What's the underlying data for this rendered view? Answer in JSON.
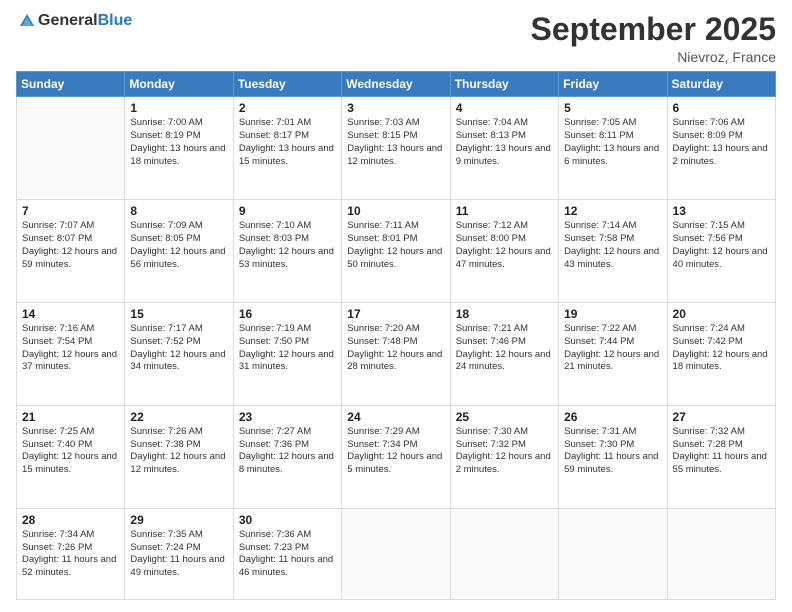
{
  "header": {
    "logo": {
      "text_general": "General",
      "text_blue": "Blue"
    },
    "title": "September 2025",
    "location": "Nievroz, France"
  },
  "calendar": {
    "days": [
      "Sunday",
      "Monday",
      "Tuesday",
      "Wednesday",
      "Thursday",
      "Friday",
      "Saturday"
    ],
    "weeks": [
      [
        {
          "day": "",
          "info": ""
        },
        {
          "day": "1",
          "info": "Sunrise: 7:00 AM\nSunset: 8:19 PM\nDaylight: 13 hours\nand 18 minutes."
        },
        {
          "day": "2",
          "info": "Sunrise: 7:01 AM\nSunset: 8:17 PM\nDaylight: 13 hours\nand 15 minutes."
        },
        {
          "day": "3",
          "info": "Sunrise: 7:03 AM\nSunset: 8:15 PM\nDaylight: 13 hours\nand 12 minutes."
        },
        {
          "day": "4",
          "info": "Sunrise: 7:04 AM\nSunset: 8:13 PM\nDaylight: 13 hours\nand 9 minutes."
        },
        {
          "day": "5",
          "info": "Sunrise: 7:05 AM\nSunset: 8:11 PM\nDaylight: 13 hours\nand 6 minutes."
        },
        {
          "day": "6",
          "info": "Sunrise: 7:06 AM\nSunset: 8:09 PM\nDaylight: 13 hours\nand 2 minutes."
        }
      ],
      [
        {
          "day": "7",
          "info": "Sunrise: 7:07 AM\nSunset: 8:07 PM\nDaylight: 12 hours\nand 59 minutes."
        },
        {
          "day": "8",
          "info": "Sunrise: 7:09 AM\nSunset: 8:05 PM\nDaylight: 12 hours\nand 56 minutes."
        },
        {
          "day": "9",
          "info": "Sunrise: 7:10 AM\nSunset: 8:03 PM\nDaylight: 12 hours\nand 53 minutes."
        },
        {
          "day": "10",
          "info": "Sunrise: 7:11 AM\nSunset: 8:01 PM\nDaylight: 12 hours\nand 50 minutes."
        },
        {
          "day": "11",
          "info": "Sunrise: 7:12 AM\nSunset: 8:00 PM\nDaylight: 12 hours\nand 47 minutes."
        },
        {
          "day": "12",
          "info": "Sunrise: 7:14 AM\nSunset: 7:58 PM\nDaylight: 12 hours\nand 43 minutes."
        },
        {
          "day": "13",
          "info": "Sunrise: 7:15 AM\nSunset: 7:56 PM\nDaylight: 12 hours\nand 40 minutes."
        }
      ],
      [
        {
          "day": "14",
          "info": "Sunrise: 7:16 AM\nSunset: 7:54 PM\nDaylight: 12 hours\nand 37 minutes."
        },
        {
          "day": "15",
          "info": "Sunrise: 7:17 AM\nSunset: 7:52 PM\nDaylight: 12 hours\nand 34 minutes."
        },
        {
          "day": "16",
          "info": "Sunrise: 7:19 AM\nSunset: 7:50 PM\nDaylight: 12 hours\nand 31 minutes."
        },
        {
          "day": "17",
          "info": "Sunrise: 7:20 AM\nSunset: 7:48 PM\nDaylight: 12 hours\nand 28 minutes."
        },
        {
          "day": "18",
          "info": "Sunrise: 7:21 AM\nSunset: 7:46 PM\nDaylight: 12 hours\nand 24 minutes."
        },
        {
          "day": "19",
          "info": "Sunrise: 7:22 AM\nSunset: 7:44 PM\nDaylight: 12 hours\nand 21 minutes."
        },
        {
          "day": "20",
          "info": "Sunrise: 7:24 AM\nSunset: 7:42 PM\nDaylight: 12 hours\nand 18 minutes."
        }
      ],
      [
        {
          "day": "21",
          "info": "Sunrise: 7:25 AM\nSunset: 7:40 PM\nDaylight: 12 hours\nand 15 minutes."
        },
        {
          "day": "22",
          "info": "Sunrise: 7:26 AM\nSunset: 7:38 PM\nDaylight: 12 hours\nand 12 minutes."
        },
        {
          "day": "23",
          "info": "Sunrise: 7:27 AM\nSunset: 7:36 PM\nDaylight: 12 hours\nand 8 minutes."
        },
        {
          "day": "24",
          "info": "Sunrise: 7:29 AM\nSunset: 7:34 PM\nDaylight: 12 hours\nand 5 minutes."
        },
        {
          "day": "25",
          "info": "Sunrise: 7:30 AM\nSunset: 7:32 PM\nDaylight: 12 hours\nand 2 minutes."
        },
        {
          "day": "26",
          "info": "Sunrise: 7:31 AM\nSunset: 7:30 PM\nDaylight: 11 hours\nand 59 minutes."
        },
        {
          "day": "27",
          "info": "Sunrise: 7:32 AM\nSunset: 7:28 PM\nDaylight: 11 hours\nand 55 minutes."
        }
      ],
      [
        {
          "day": "28",
          "info": "Sunrise: 7:34 AM\nSunset: 7:26 PM\nDaylight: 11 hours\nand 52 minutes."
        },
        {
          "day": "29",
          "info": "Sunrise: 7:35 AM\nSunset: 7:24 PM\nDaylight: 11 hours\nand 49 minutes."
        },
        {
          "day": "30",
          "info": "Sunrise: 7:36 AM\nSunset: 7:23 PM\nDaylight: 11 hours\nand 46 minutes."
        },
        {
          "day": "",
          "info": ""
        },
        {
          "day": "",
          "info": ""
        },
        {
          "day": "",
          "info": ""
        },
        {
          "day": "",
          "info": ""
        }
      ]
    ]
  }
}
